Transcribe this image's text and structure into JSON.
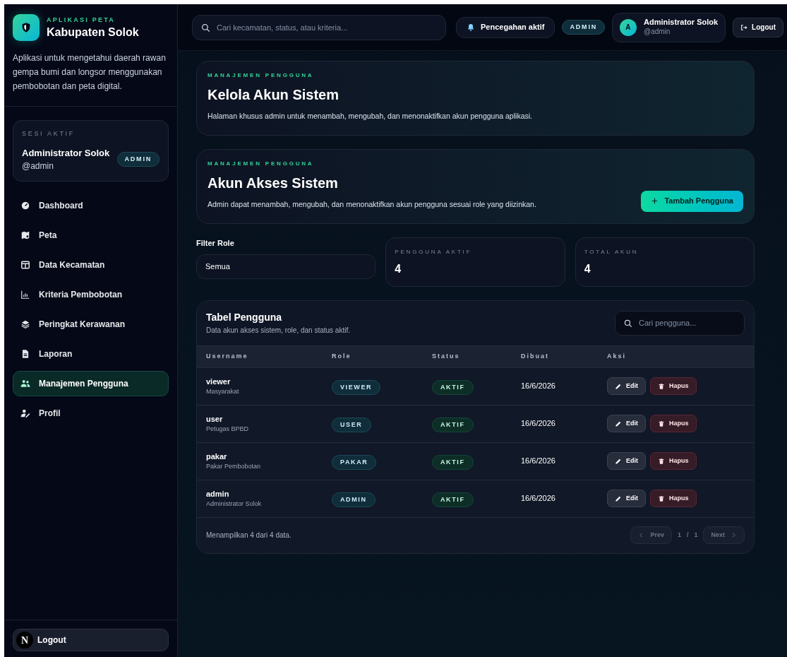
{
  "sidebar": {
    "brand": {
      "eyebrow": "APLIKASI PETA",
      "title": "Kabupaten Solok"
    },
    "description": "Aplikasi untuk mengetahui daerah rawan gempa bumi dan longsor menggunakan pembobotan dan peta digital.",
    "session": {
      "label": "SESI AKTIF",
      "name": "Administrator Solok",
      "username": "@admin",
      "role": "ADMIN"
    },
    "items": [
      {
        "label": "Dashboard",
        "selected": false
      },
      {
        "label": "Peta",
        "selected": false
      },
      {
        "label": "Data Kecamatan",
        "selected": false
      },
      {
        "label": "Kriteria Pembobotan",
        "selected": false
      },
      {
        "label": "Peringkat Kerawanan",
        "selected": false
      },
      {
        "label": "Laporan",
        "selected": false
      },
      {
        "label": "Manajemen Pengguna",
        "selected": true
      },
      {
        "label": "Profil",
        "selected": false
      }
    ],
    "dev_badge": "N",
    "logout": "Logout"
  },
  "topbar": {
    "search": {
      "placeholder": "Cari kecamatan, status, atau kriteria..."
    },
    "alert": "Pencegahan aktif",
    "role": "ADMIN",
    "user": {
      "initial": "A",
      "name": "Administrator Solok",
      "username": "@admin"
    },
    "logout": "Logout"
  },
  "hero": {
    "eyebrow": "MANAJEMEN PENGGUNA",
    "title": "Kelola Akun Sistem",
    "description": "Halaman khusus admin untuk menambah, mengubah, dan menonaktifkan akun pengguna aplikasi."
  },
  "access": {
    "eyebrow": "MANAJEMEN PENGGUNA",
    "title": "Akun Akses Sistem",
    "description": "Admin dapat menambah, mengubah, dan menonaktifkan akun pengguna sesuai role yang diizinkan.",
    "add_button": "Tambah Pengguna"
  },
  "filter": {
    "label": "Filter Role",
    "value": "Semua"
  },
  "stats": [
    {
      "label": "PENGGUNA AKTIF",
      "value": "4"
    },
    {
      "label": "TOTAL AKUN",
      "value": "4"
    }
  ],
  "table": {
    "title": "Tabel Pengguna",
    "subtitle": "Data akun akses sistem, role, dan status aktif.",
    "search": {
      "placeholder": "Cari pengguna..."
    },
    "columns": [
      "Username",
      "Role",
      "Status",
      "Dibuat",
      "Aksi"
    ],
    "rows": [
      {
        "username": "viewer",
        "name": "Masyarakat",
        "role": "VIEWER",
        "status": "AKTIF",
        "created": "16/6/2026",
        "edit": "Edit",
        "delete": "Hapus"
      },
      {
        "username": "user",
        "name": "Petugas BPBD",
        "role": "USER",
        "status": "AKTIF",
        "created": "16/6/2026",
        "edit": "Edit",
        "delete": "Hapus"
      },
      {
        "username": "pakar",
        "name": "Pakar Pembobotan",
        "role": "PAKAR",
        "status": "AKTIF",
        "created": "16/6/2026",
        "edit": "Edit",
        "delete": "Hapus"
      },
      {
        "username": "admin",
        "name": "Administrator Solok",
        "role": "ADMIN",
        "status": "AKTIF",
        "created": "16/6/2026",
        "edit": "Edit",
        "delete": "Hapus"
      }
    ],
    "summary": "Menampilkan 4 dari 4 data.",
    "pagination": {
      "prev": "Prev",
      "page": "1",
      "separator": "/",
      "total": "1",
      "next": "Next"
    }
  }
}
